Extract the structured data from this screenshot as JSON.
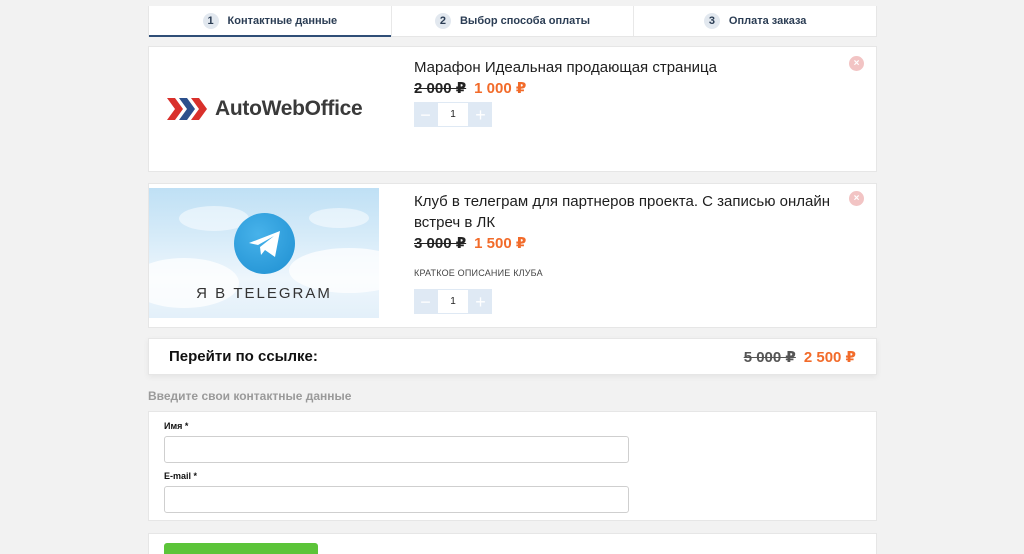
{
  "steps": [
    {
      "num": "1",
      "label": "Контактные данные",
      "active": true
    },
    {
      "num": "2",
      "label": "Выбор способа оплаты",
      "active": false
    },
    {
      "num": "3",
      "label": "Оплата заказа",
      "active": false
    }
  ],
  "products": [
    {
      "title": "Марафон Идеальная продающая страница",
      "old_price": "2 000 ₽",
      "new_price": "1 000 ₽",
      "quantity": "1",
      "logo_text": "AutoWebOffice"
    },
    {
      "title": "Клуб в телеграм для партнеров проекта. С записью онлайн встреч в ЛК",
      "old_price": "3 000 ₽",
      "new_price": "1 500 ₽",
      "description": "КРАТКОЕ ОПИСАНИЕ КЛУБА",
      "quantity": "1",
      "banner_text": "Я В TELEGRAM"
    }
  ],
  "controls": {
    "minus": "−",
    "plus": "+",
    "remove": "×"
  },
  "total": {
    "label": "Перейти по ссылке:",
    "old_price": "5 000 ₽",
    "new_price": "2 500 ₽"
  },
  "contact": {
    "section_title": "Введите свои контактные данные",
    "name_label": "Имя *",
    "name_value": "",
    "email_label": "E-mail *",
    "email_value": ""
  },
  "colors": {
    "accent": "#f26b2a",
    "step_active": "#2f4e77",
    "stepper": "#dfe9f4",
    "submit": "#5cc439"
  }
}
